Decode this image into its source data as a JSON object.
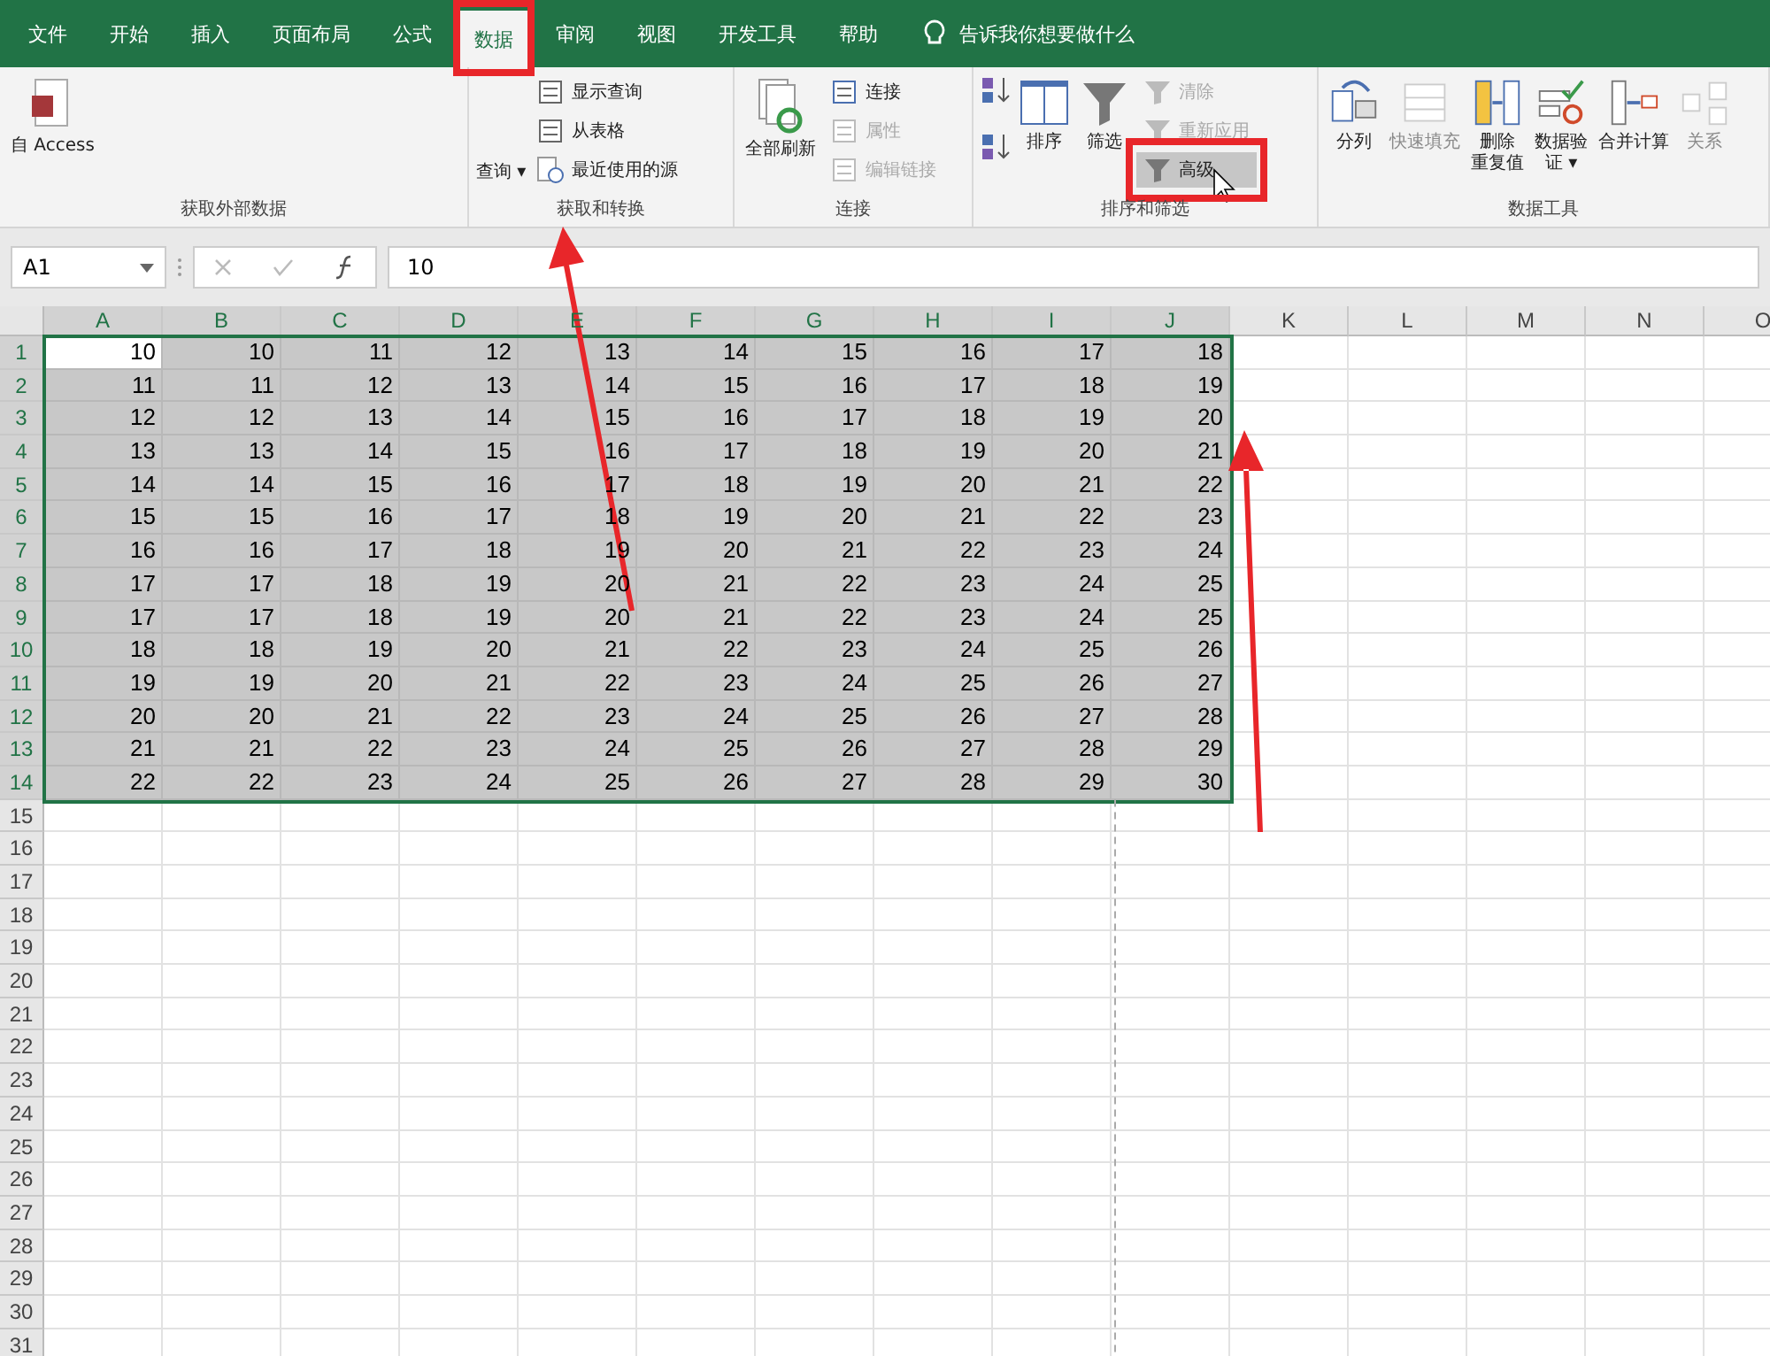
{
  "tabs": [
    {
      "label": "文件",
      "selected": false,
      "highlighted": false
    },
    {
      "label": "开始",
      "selected": false,
      "highlighted": false
    },
    {
      "label": "插入",
      "selected": false,
      "highlighted": false
    },
    {
      "label": "页面布局",
      "selected": false,
      "highlighted": false
    },
    {
      "label": "公式",
      "selected": false,
      "highlighted": false
    },
    {
      "label": "数据",
      "selected": true,
      "highlighted": true
    },
    {
      "label": "审阅",
      "selected": false,
      "highlighted": false
    },
    {
      "label": "视图",
      "selected": false,
      "highlighted": false
    },
    {
      "label": "开发工具",
      "selected": false,
      "highlighted": false
    },
    {
      "label": "帮助",
      "selected": false,
      "highlighted": false
    }
  ],
  "tell_me": "告诉我你想要做什么",
  "ribbon_groups": [
    {
      "label": "获取外部数据",
      "items": [
        {
          "lines": [
            "自 Access"
          ],
          "kind": "large",
          "disabled": false
        }
      ]
    },
    {
      "label": "获取和转换",
      "items": [
        {
          "label": "查询 ▾",
          "kind": "caption"
        },
        {
          "label": "显示查询",
          "kind": "small",
          "disabled": false,
          "hovered": false,
          "highlighted": false
        },
        {
          "label": "从表格",
          "kind": "small",
          "disabled": false,
          "hovered": false,
          "highlighted": false
        },
        {
          "label": "最近使用的源",
          "kind": "small",
          "disabled": false,
          "hovered": false,
          "highlighted": false
        }
      ]
    },
    {
      "label": "连接",
      "items": [
        {
          "lines": [
            "全部刷新"
          ],
          "kind": "large",
          "disabled": false
        },
        {
          "label": "连接",
          "kind": "small",
          "disabled": false,
          "hovered": false,
          "highlighted": false
        },
        {
          "label": "属性",
          "kind": "small",
          "disabled": true,
          "hovered": false,
          "highlighted": false
        },
        {
          "label": "编辑链接",
          "kind": "small",
          "disabled": true,
          "hovered": false,
          "highlighted": false
        }
      ]
    },
    {
      "label": "排序和筛选",
      "items": [
        {
          "kind": "sortpair"
        },
        {
          "lines": [
            "排序"
          ],
          "kind": "large",
          "disabled": false
        },
        {
          "lines": [
            "筛选"
          ],
          "kind": "large",
          "disabled": false
        },
        {
          "label": "清除",
          "kind": "small",
          "disabled": true,
          "hovered": false,
          "highlighted": false
        },
        {
          "label": "重新应用",
          "kind": "small",
          "disabled": true,
          "hovered": false,
          "highlighted": false
        },
        {
          "label": "高级",
          "kind": "small",
          "disabled": false,
          "hovered": true,
          "highlighted": true
        }
      ]
    },
    {
      "label": "数据工具",
      "items": [
        {
          "lines": [
            "分列"
          ],
          "kind": "large",
          "disabled": false
        },
        {
          "lines": [
            "快速填充"
          ],
          "kind": "large",
          "disabled": true
        },
        {
          "lines": [
            "删除",
            "重复值"
          ],
          "kind": "large",
          "disabled": false
        },
        {
          "lines": [
            "数据验",
            "证 ▾"
          ],
          "kind": "large",
          "disabled": false
        },
        {
          "lines": [
            "合并计算"
          ],
          "kind": "large",
          "disabled": false
        },
        {
          "lines": [
            "关系"
          ],
          "kind": "large",
          "disabled": true
        }
      ]
    }
  ],
  "name_box": "A1",
  "formula": "10",
  "columns": [
    {
      "label": "A",
      "selected": true
    },
    {
      "label": "B",
      "selected": true
    },
    {
      "label": "C",
      "selected": true
    },
    {
      "label": "D",
      "selected": true
    },
    {
      "label": "E",
      "selected": true
    },
    {
      "label": "F",
      "selected": true
    },
    {
      "label": "G",
      "selected": true
    },
    {
      "label": "H",
      "selected": true
    },
    {
      "label": "I",
      "selected": true
    },
    {
      "label": "J",
      "selected": true
    },
    {
      "label": "K",
      "selected": false
    },
    {
      "label": "L",
      "selected": false
    },
    {
      "label": "M",
      "selected": false
    },
    {
      "label": "N",
      "selected": false
    },
    {
      "label": "O",
      "selected": false
    }
  ],
  "rows": [
    {
      "label": "1",
      "selected": true,
      "cells": [
        {
          "value": "10",
          "active": true
        },
        {
          "value": "10",
          "active": false
        },
        {
          "value": "11",
          "active": false
        },
        {
          "value": "12",
          "active": false
        },
        {
          "value": "13",
          "active": false
        },
        {
          "value": "14",
          "active": false
        },
        {
          "value": "15",
          "active": false
        },
        {
          "value": "16",
          "active": false
        },
        {
          "value": "17",
          "active": false
        },
        {
          "value": "18",
          "active": false
        }
      ]
    },
    {
      "label": "2",
      "selected": true,
      "cells": [
        {
          "value": "11",
          "active": false
        },
        {
          "value": "11",
          "active": false
        },
        {
          "value": "12",
          "active": false
        },
        {
          "value": "13",
          "active": false
        },
        {
          "value": "14",
          "active": false
        },
        {
          "value": "15",
          "active": false
        },
        {
          "value": "16",
          "active": false
        },
        {
          "value": "17",
          "active": false
        },
        {
          "value": "18",
          "active": false
        },
        {
          "value": "19",
          "active": false
        }
      ]
    },
    {
      "label": "3",
      "selected": true,
      "cells": [
        {
          "value": "12",
          "active": false
        },
        {
          "value": "12",
          "active": false
        },
        {
          "value": "13",
          "active": false
        },
        {
          "value": "14",
          "active": false
        },
        {
          "value": "15",
          "active": false
        },
        {
          "value": "16",
          "active": false
        },
        {
          "value": "17",
          "active": false
        },
        {
          "value": "18",
          "active": false
        },
        {
          "value": "19",
          "active": false
        },
        {
          "value": "20",
          "active": false
        }
      ]
    },
    {
      "label": "4",
      "selected": true,
      "cells": [
        {
          "value": "13",
          "active": false
        },
        {
          "value": "13",
          "active": false
        },
        {
          "value": "14",
          "active": false
        },
        {
          "value": "15",
          "active": false
        },
        {
          "value": "16",
          "active": false
        },
        {
          "value": "17",
          "active": false
        },
        {
          "value": "18",
          "active": false
        },
        {
          "value": "19",
          "active": false
        },
        {
          "value": "20",
          "active": false
        },
        {
          "value": "21",
          "active": false
        }
      ]
    },
    {
      "label": "5",
      "selected": true,
      "cells": [
        {
          "value": "14",
          "active": false
        },
        {
          "value": "14",
          "active": false
        },
        {
          "value": "15",
          "active": false
        },
        {
          "value": "16",
          "active": false
        },
        {
          "value": "17",
          "active": false
        },
        {
          "value": "18",
          "active": false
        },
        {
          "value": "19",
          "active": false
        },
        {
          "value": "20",
          "active": false
        },
        {
          "value": "21",
          "active": false
        },
        {
          "value": "22",
          "active": false
        }
      ]
    },
    {
      "label": "6",
      "selected": true,
      "cells": [
        {
          "value": "15",
          "active": false
        },
        {
          "value": "15",
          "active": false
        },
        {
          "value": "16",
          "active": false
        },
        {
          "value": "17",
          "active": false
        },
        {
          "value": "18",
          "active": false
        },
        {
          "value": "19",
          "active": false
        },
        {
          "value": "20",
          "active": false
        },
        {
          "value": "21",
          "active": false
        },
        {
          "value": "22",
          "active": false
        },
        {
          "value": "23",
          "active": false
        }
      ]
    },
    {
      "label": "7",
      "selected": true,
      "cells": [
        {
          "value": "16",
          "active": false
        },
        {
          "value": "16",
          "active": false
        },
        {
          "value": "17",
          "active": false
        },
        {
          "value": "18",
          "active": false
        },
        {
          "value": "19",
          "active": false
        },
        {
          "value": "20",
          "active": false
        },
        {
          "value": "21",
          "active": false
        },
        {
          "value": "22",
          "active": false
        },
        {
          "value": "23",
          "active": false
        },
        {
          "value": "24",
          "active": false
        }
      ]
    },
    {
      "label": "8",
      "selected": true,
      "cells": [
        {
          "value": "17",
          "active": false
        },
        {
          "value": "17",
          "active": false
        },
        {
          "value": "18",
          "active": false
        },
        {
          "value": "19",
          "active": false
        },
        {
          "value": "20",
          "active": false
        },
        {
          "value": "21",
          "active": false
        },
        {
          "value": "22",
          "active": false
        },
        {
          "value": "23",
          "active": false
        },
        {
          "value": "24",
          "active": false
        },
        {
          "value": "25",
          "active": false
        }
      ]
    },
    {
      "label": "9",
      "selected": true,
      "cells": [
        {
          "value": "17",
          "active": false
        },
        {
          "value": "17",
          "active": false
        },
        {
          "value": "18",
          "active": false
        },
        {
          "value": "19",
          "active": false
        },
        {
          "value": "20",
          "active": false
        },
        {
          "value": "21",
          "active": false
        },
        {
          "value": "22",
          "active": false
        },
        {
          "value": "23",
          "active": false
        },
        {
          "value": "24",
          "active": false
        },
        {
          "value": "25",
          "active": false
        }
      ]
    },
    {
      "label": "10",
      "selected": true,
      "cells": [
        {
          "value": "18",
          "active": false
        },
        {
          "value": "18",
          "active": false
        },
        {
          "value": "19",
          "active": false
        },
        {
          "value": "20",
          "active": false
        },
        {
          "value": "21",
          "active": false
        },
        {
          "value": "22",
          "active": false
        },
        {
          "value": "23",
          "active": false
        },
        {
          "value": "24",
          "active": false
        },
        {
          "value": "25",
          "active": false
        },
        {
          "value": "26",
          "active": false
        }
      ]
    },
    {
      "label": "11",
      "selected": true,
      "cells": [
        {
          "value": "19",
          "active": false
        },
        {
          "value": "19",
          "active": false
        },
        {
          "value": "20",
          "active": false
        },
        {
          "value": "21",
          "active": false
        },
        {
          "value": "22",
          "active": false
        },
        {
          "value": "23",
          "active": false
        },
        {
          "value": "24",
          "active": false
        },
        {
          "value": "25",
          "active": false
        },
        {
          "value": "26",
          "active": false
        },
        {
          "value": "27",
          "active": false
        }
      ]
    },
    {
      "label": "12",
      "selected": true,
      "cells": [
        {
          "value": "20",
          "active": false
        },
        {
          "value": "20",
          "active": false
        },
        {
          "value": "21",
          "active": false
        },
        {
          "value": "22",
          "active": false
        },
        {
          "value": "23",
          "active": false
        },
        {
          "value": "24",
          "active": false
        },
        {
          "value": "25",
          "active": false
        },
        {
          "value": "26",
          "active": false
        },
        {
          "value": "27",
          "active": false
        },
        {
          "value": "28",
          "active": false
        }
      ]
    },
    {
      "label": "13",
      "selected": true,
      "cells": [
        {
          "value": "21",
          "active": false
        },
        {
          "value": "21",
          "active": false
        },
        {
          "value": "22",
          "active": false
        },
        {
          "value": "23",
          "active": false
        },
        {
          "value": "24",
          "active": false
        },
        {
          "value": "25",
          "active": false
        },
        {
          "value": "26",
          "active": false
        },
        {
          "value": "27",
          "active": false
        },
        {
          "value": "28",
          "active": false
        },
        {
          "value": "29",
          "active": false
        }
      ]
    },
    {
      "label": "14",
      "selected": true,
      "cells": [
        {
          "value": "22",
          "active": false
        },
        {
          "value": "22",
          "active": false
        },
        {
          "value": "23",
          "active": false
        },
        {
          "value": "24",
          "active": false
        },
        {
          "value": "25",
          "active": false
        },
        {
          "value": "26",
          "active": false
        },
        {
          "value": "27",
          "active": false
        },
        {
          "value": "28",
          "active": false
        },
        {
          "value": "29",
          "active": false
        },
        {
          "value": "30",
          "active": false
        }
      ]
    },
    {
      "label": "15",
      "selected": false
    },
    {
      "label": "16",
      "selected": false
    },
    {
      "label": "17",
      "selected": false
    },
    {
      "label": "18",
      "selected": false
    },
    {
      "label": "19",
      "selected": false
    },
    {
      "label": "20",
      "selected": false
    },
    {
      "label": "21",
      "selected": false
    },
    {
      "label": "22",
      "selected": false
    },
    {
      "label": "23",
      "selected": false
    },
    {
      "label": "24",
      "selected": false
    },
    {
      "label": "25",
      "selected": false
    },
    {
      "label": "26",
      "selected": false
    },
    {
      "label": "27",
      "selected": false
    },
    {
      "label": "28",
      "selected": false
    },
    {
      "label": "29",
      "selected": false
    },
    {
      "label": "30",
      "selected": false
    },
    {
      "label": "31",
      "selected": false
    }
  ]
}
